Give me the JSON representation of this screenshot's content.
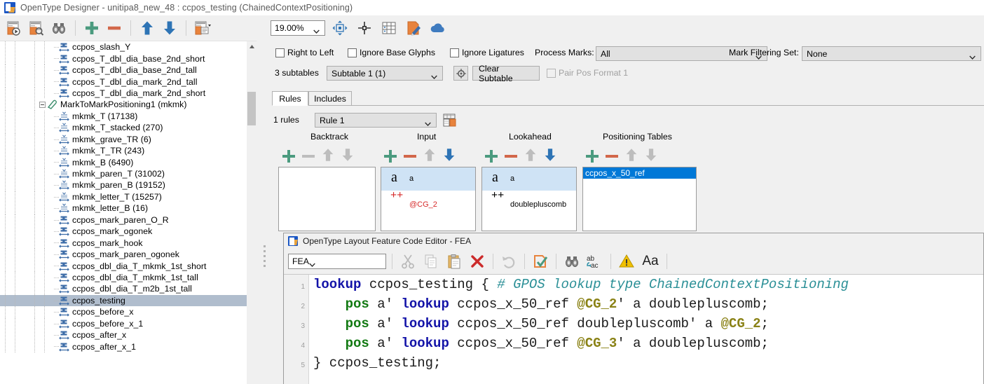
{
  "window": {
    "title": "OpenType Designer - unitipa8_new_48 : ccpos_testing (ChainedContextPositioning)",
    "app_icon": "opentype-designer-icon"
  },
  "left_toolbar": {
    "buttons": [
      {
        "name": "preview-lookup-icon",
        "label": "Preview Lookup"
      },
      {
        "name": "inspect-lookup-icon",
        "label": "Inspect Lookup"
      },
      {
        "name": "find-icon",
        "label": "Find"
      },
      {
        "name": "add-icon",
        "label": "Add"
      },
      {
        "name": "remove-icon",
        "label": "Remove"
      },
      {
        "name": "move-up-icon",
        "label": "Move Up"
      },
      {
        "name": "move-down-icon",
        "label": "Move Down"
      },
      {
        "name": "options-dropdown-icon",
        "label": "Options"
      }
    ]
  },
  "view_toolbar": {
    "zoom": {
      "value": "19.00%",
      "name": "zoom-combo"
    },
    "buttons": [
      {
        "name": "fit-to-window-icon",
        "label": "Fit To Window"
      },
      {
        "name": "center-origin-icon",
        "label": "Center Origin"
      },
      {
        "name": "glyph-grid-icon",
        "label": "Glyph Grid"
      },
      {
        "name": "edit-glyph-icon",
        "label": "Edit Glyph"
      },
      {
        "name": "cloud-icon",
        "label": "Cloud"
      }
    ]
  },
  "tree": {
    "items": [
      {
        "label": "ccpos_slash_Y",
        "icon": "ccpos-rule-icon",
        "indent": 6,
        "selected": false
      },
      {
        "label": "ccpos_T_dbl_dia_base_2nd_short",
        "icon": "ccpos-rule-icon",
        "indent": 6,
        "selected": false
      },
      {
        "label": "ccpos_T_dbl_dia_base_2nd_tall",
        "icon": "ccpos-rule-icon",
        "indent": 6,
        "selected": false
      },
      {
        "label": "ccpos_T_dbl_dia_mark_2nd_tall",
        "icon": "ccpos-rule-icon",
        "indent": 6,
        "selected": false
      },
      {
        "label": "ccpos_T_dbl_dia_mark_2nd_short",
        "icon": "ccpos-rule-icon",
        "indent": 6,
        "selected": false
      },
      {
        "label": "MarkToMarkPositioning1 (mkmk)",
        "icon": "feature-group-icon",
        "indent": 4,
        "selected": false,
        "expander": true
      },
      {
        "label": "mkmk_T (17138)",
        "icon": "mkmk-rule-icon",
        "indent": 6,
        "selected": false
      },
      {
        "label": "mkmk_T_stacked (270)",
        "icon": "mkmk-rule-icon",
        "indent": 6,
        "selected": false
      },
      {
        "label": "mkmk_grave_TR (6)",
        "icon": "mkmk-rule-icon",
        "indent": 6,
        "selected": false
      },
      {
        "label": "mkmk_T_TR (243)",
        "icon": "mkmk-rule-icon",
        "indent": 6,
        "selected": false
      },
      {
        "label": "mkmk_B (6490)",
        "icon": "mkmk-rule-icon",
        "indent": 6,
        "selected": false
      },
      {
        "label": "mkmk_paren_T (31002)",
        "icon": "mkmk-rule-icon",
        "indent": 6,
        "selected": false
      },
      {
        "label": "mkmk_paren_B (19152)",
        "icon": "mkmk-rule-icon",
        "indent": 6,
        "selected": false
      },
      {
        "label": "mkmk_letter_T (15257)",
        "icon": "mkmk-rule-icon",
        "indent": 6,
        "selected": false
      },
      {
        "label": "mkmk_letter_B (16)",
        "icon": "mkmk-rule-icon",
        "indent": 6,
        "selected": false
      },
      {
        "label": "ccpos_mark_paren_O_R",
        "icon": "ccpos-rule-icon",
        "indent": 6,
        "selected": false
      },
      {
        "label": "ccpos_mark_ogonek",
        "icon": "ccpos-rule-icon",
        "indent": 6,
        "selected": false
      },
      {
        "label": "ccpos_mark_hook",
        "icon": "ccpos-rule-icon",
        "indent": 6,
        "selected": false
      },
      {
        "label": "ccpos_mark_paren_ogonek",
        "icon": "ccpos-rule-icon",
        "indent": 6,
        "selected": false
      },
      {
        "label": "ccpos_dbl_dia_T_mkmk_1st_short",
        "icon": "ccpos-rule-icon",
        "indent": 6,
        "selected": false
      },
      {
        "label": "ccpos_dbl_dia_T_mkmk_1st_tall",
        "icon": "ccpos-rule-icon",
        "indent": 6,
        "selected": false
      },
      {
        "label": "ccpos_dbl_dia_T_m2b_1st_tall",
        "icon": "ccpos-rule-icon",
        "indent": 6,
        "selected": false
      },
      {
        "label": "ccpos_testing",
        "icon": "ccpos-rule-icon",
        "indent": 6,
        "selected": true
      },
      {
        "label": "ccpos_before_x",
        "icon": "ccpos-rule-icon",
        "indent": 6,
        "selected": false
      },
      {
        "label": "ccpos_before_x_1",
        "icon": "ccpos-rule-icon",
        "indent": 6,
        "selected": false
      },
      {
        "label": "ccpos_after_x",
        "icon": "ccpos-rule-icon",
        "indent": 6,
        "selected": false
      },
      {
        "label": "ccpos_after_x_1",
        "icon": "ccpos-rule-icon",
        "indent": 6,
        "selected": false
      }
    ]
  },
  "lookup_flags": {
    "right_to_left": {
      "label": "Right to Left",
      "checked": false,
      "mnemonic": "R"
    },
    "ignore_base_glyphs": {
      "label": "Ignore Base Glyphs",
      "checked": false,
      "mnemonic": "B"
    },
    "ignore_ligatures": {
      "label": "Ignore Ligatures",
      "checked": false,
      "mnemonic": "L"
    },
    "process_marks": {
      "label": "Process Marks:",
      "value": "All"
    },
    "mark_filtering_set": {
      "label": "Mark Filtering Set:",
      "value": "None"
    }
  },
  "subtable_row": {
    "count_label": "3 subtables",
    "subtable_value": "Subtable 1 (1)",
    "settings_icon": "gear-icon",
    "clear_button": "Clear Subtable",
    "pair_pos_format": {
      "label": "Pair Pos Format 1",
      "checked": false,
      "disabled": true
    }
  },
  "tabs": [
    {
      "label": "Rules",
      "active": true
    },
    {
      "label": "Includes",
      "active": false
    }
  ],
  "rules": {
    "count_label": "1 rules",
    "selected_rule": "Rule 1",
    "calc_icon": "rule-table-icon",
    "columns": [
      {
        "title": "Backtrack",
        "plus": true,
        "minus": false,
        "up": false,
        "down": false
      },
      {
        "title": "Input",
        "plus": true,
        "minus": true,
        "up": false,
        "down": true
      },
      {
        "title": "Lookahead",
        "plus": true,
        "minus": true,
        "up": false,
        "down": true
      },
      {
        "title": "Positioning Tables",
        "plus": true,
        "minus": true,
        "up": false,
        "down": false
      }
    ]
  },
  "panels": {
    "backtrack": {
      "entries": []
    },
    "input": {
      "entries": [
        {
          "glyph": "a",
          "name": "a",
          "selected": true,
          "red": false
        },
        {
          "glyph": "++",
          "name": "@CG_2",
          "selected": false,
          "red": true
        }
      ]
    },
    "lookahead": {
      "entries": [
        {
          "glyph": "a",
          "name": "a",
          "selected": true,
          "red": false
        },
        {
          "glyph": "++",
          "name": "doublepluscomb",
          "selected": false,
          "red": false
        }
      ]
    },
    "positioning_tables": {
      "entries": [
        {
          "name": "ccpos_x_50_ref",
          "selected": true
        }
      ]
    }
  },
  "code_editor": {
    "title": "OpenType Layout Feature Code Editor - FEA",
    "app_icon": "opentype-designer-icon",
    "format_select": "FEA",
    "toolbar": [
      {
        "name": "cut-icon",
        "label": "Cut",
        "disabled": true
      },
      {
        "name": "copy-icon",
        "label": "Copy",
        "disabled": true
      },
      {
        "name": "paste-icon",
        "label": "Paste",
        "disabled": false
      },
      {
        "name": "delete-icon",
        "label": "Delete",
        "disabled": false
      },
      {
        "name": "undo-icon",
        "label": "Undo",
        "disabled": true
      },
      {
        "name": "apply-icon",
        "label": "Apply",
        "disabled": false
      },
      {
        "name": "find-icon",
        "label": "Find",
        "disabled": false
      },
      {
        "name": "replace-icon",
        "label": "Replace",
        "disabled": false
      },
      {
        "name": "warning-icon",
        "label": "Warnings",
        "disabled": false
      },
      {
        "name": "font-icon",
        "label": "Font",
        "disabled": false
      }
    ],
    "lines": [
      {
        "num": "1",
        "tokens": [
          {
            "t": "lookup",
            "c": "k-lookup"
          },
          {
            "t": " ccpos_testing { ",
            "c": ""
          },
          {
            "t": "# GPOS lookup type ChainedContextPositioning",
            "c": "k-cmt"
          }
        ]
      },
      {
        "num": "2",
        "tokens": [
          {
            "t": "    ",
            "c": ""
          },
          {
            "t": "pos",
            "c": "k-pos"
          },
          {
            "t": " a' ",
            "c": ""
          },
          {
            "t": "lookup",
            "c": "k-lookup"
          },
          {
            "t": " ccpos_x_50_ref ",
            "c": ""
          },
          {
            "t": "@CG_2",
            "c": "k-cls"
          },
          {
            "t": "' a doublepluscomb;",
            "c": ""
          }
        ]
      },
      {
        "num": "3",
        "tokens": [
          {
            "t": "    ",
            "c": ""
          },
          {
            "t": "pos",
            "c": "k-pos"
          },
          {
            "t": " a' ",
            "c": ""
          },
          {
            "t": "lookup",
            "c": "k-lookup"
          },
          {
            "t": " ccpos_x_50_ref doublepluscomb' a ",
            "c": ""
          },
          {
            "t": "@CG_2",
            "c": "k-cls"
          },
          {
            "t": ";",
            "c": ""
          }
        ]
      },
      {
        "num": "4",
        "tokens": [
          {
            "t": "    ",
            "c": ""
          },
          {
            "t": "pos",
            "c": "k-pos"
          },
          {
            "t": " a' ",
            "c": ""
          },
          {
            "t": "lookup",
            "c": "k-lookup"
          },
          {
            "t": " ccpos_x_50_ref ",
            "c": ""
          },
          {
            "t": "@CG_3",
            "c": "k-cls"
          },
          {
            "t": "' a doublepluscomb;",
            "c": ""
          }
        ]
      },
      {
        "num": "5",
        "tokens": [
          {
            "t": "} ccpos_testing;",
            "c": ""
          }
        ]
      }
    ]
  },
  "colors": {
    "accent_green": "#4b9b7f",
    "accent_red": "#d2674a",
    "accent_blue": "#2e74b5",
    "selection_blue": "#0078d7",
    "tree_selection": "#b0bdcd",
    "glyph_selection": "#cfe3f5"
  }
}
